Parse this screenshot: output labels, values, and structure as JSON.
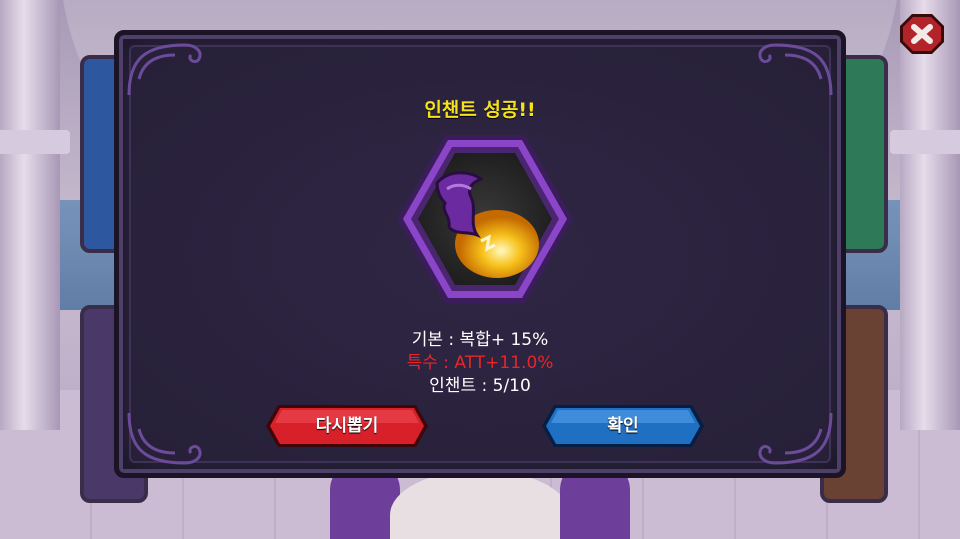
{
  "dialog": {
    "title": "인챈트 성공!!",
    "stats": {
      "base": "기본 : 복합+ 15%",
      "special": "특수 : ATT+11.0%",
      "enchant": "인챈트 : 5/10"
    },
    "buttons": {
      "redraw_label": "다시뽑기",
      "confirm_label": "확인"
    }
  },
  "colors": {
    "title": "#f4e21a",
    "special_stat": "#e8262a",
    "redraw_button": "#d8202a",
    "confirm_button": "#1f6fc2",
    "frame_purple": "#7a3dba"
  },
  "icons": {
    "close": "close-x-icon",
    "item": "enchant-stone-icon"
  }
}
